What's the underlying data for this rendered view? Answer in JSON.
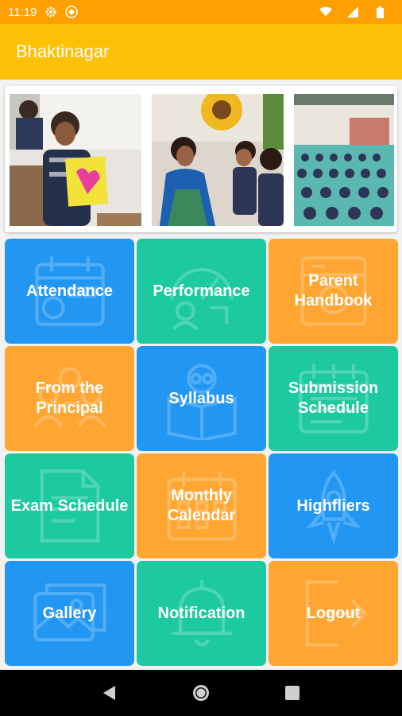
{
  "status_bar": {
    "time": "11:19",
    "icons": [
      "gear-icon",
      "app-notification-icon",
      "wifi-icon",
      "signal-icon",
      "battery-icon"
    ]
  },
  "app_bar": {
    "title": "Bhaktinagar"
  },
  "colors": {
    "status_bar": "#ffa000",
    "app_bar": "#ffc107",
    "blue": "#2196f3",
    "green": "#1dc99e",
    "orange": "#ffa632"
  },
  "gallery": {
    "photos": [
      "student-holding-artwork-photo",
      "teacher-with-children-photo",
      "students-assembly-photo"
    ]
  },
  "tiles": [
    {
      "label": "Attendance",
      "color": "blue",
      "icon": "calendar-icon"
    },
    {
      "label": "Performance",
      "color": "green",
      "icon": "performance-gauge-icon"
    },
    {
      "label": "Parent Handbook",
      "color": "orange",
      "icon": "handbook-icon"
    },
    {
      "label": "From the Principal",
      "color": "orange",
      "icon": "principal-people-icon"
    },
    {
      "label": "Syllabus",
      "color": "blue",
      "icon": "reading-book-icon"
    },
    {
      "label": "Submission Schedule",
      "color": "green",
      "icon": "schedule-calendar-icon"
    },
    {
      "label": "Exam Schedule",
      "color": "green",
      "icon": "exam-document-icon"
    },
    {
      "label": "Monthly Calendar",
      "color": "orange",
      "icon": "monthly-calendar-icon"
    },
    {
      "label": "Highfliers",
      "color": "blue",
      "icon": "rocket-icon"
    },
    {
      "label": "Gallery",
      "color": "blue",
      "icon": "photo-gallery-icon"
    },
    {
      "label": "Notification",
      "color": "green",
      "icon": "bell-icon"
    },
    {
      "label": "Logout",
      "color": "orange",
      "icon": "logout-icon"
    }
  ],
  "nav_bar": {
    "buttons": [
      "back-icon",
      "home-icon",
      "recents-icon"
    ]
  }
}
